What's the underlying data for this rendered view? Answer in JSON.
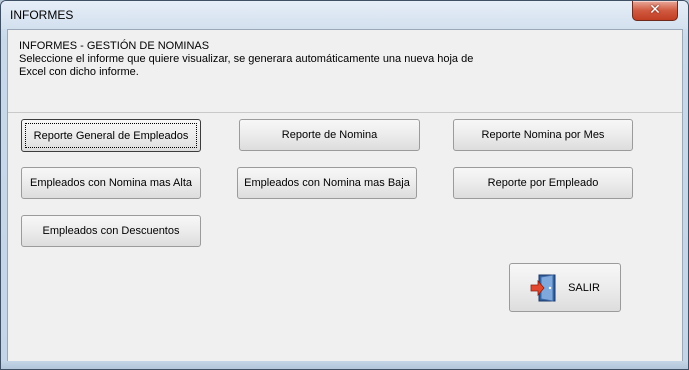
{
  "window": {
    "title": "INFORMES",
    "close_label": "✕"
  },
  "info": {
    "heading": "INFORMES - GESTIÓN DE NOMINAS",
    "line1": "Seleccione el informe que quiere visualizar, se generara automáticamente una nueva hoja de",
    "line2": "Excel con dicho informe."
  },
  "buttons": {
    "reporte_general": "Reporte General de Empleados",
    "reporte_nomina": "Reporte de Nomina",
    "reporte_nomina_mes": "Reporte Nomina por Mes",
    "nomina_alta": "Empleados con Nomina mas Alta",
    "nomina_baja": "Empleados con Nomina mas Baja",
    "reporte_empleado": "Reporte por Empleado",
    "descuentos": "Empleados con Descuentos",
    "salir": "SALIR"
  },
  "icons": {
    "exit": "exit-door-icon"
  }
}
